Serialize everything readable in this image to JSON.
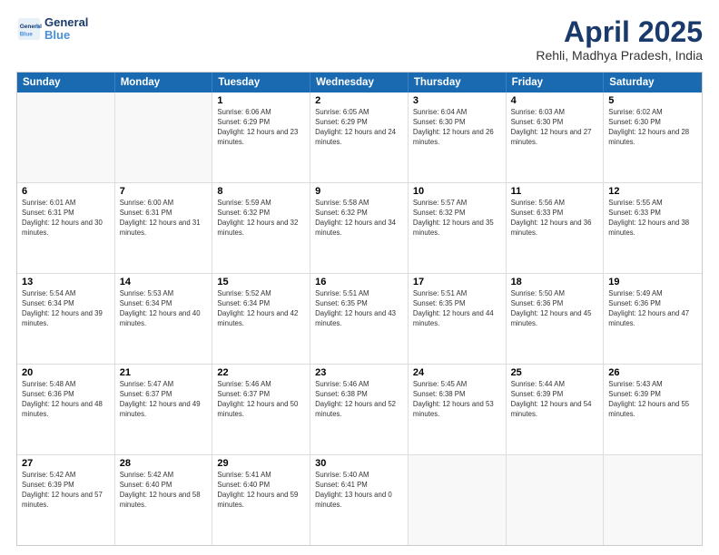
{
  "header": {
    "logo_line1": "General",
    "logo_line2": "Blue",
    "month": "April 2025",
    "location": "Rehli, Madhya Pradesh, India"
  },
  "days_of_week": [
    "Sunday",
    "Monday",
    "Tuesday",
    "Wednesday",
    "Thursday",
    "Friday",
    "Saturday"
  ],
  "weeks": [
    [
      {
        "day": "",
        "sunrise": "",
        "sunset": "",
        "daylight": ""
      },
      {
        "day": "",
        "sunrise": "",
        "sunset": "",
        "daylight": ""
      },
      {
        "day": "1",
        "sunrise": "Sunrise: 6:06 AM",
        "sunset": "Sunset: 6:29 PM",
        "daylight": "Daylight: 12 hours and 23 minutes."
      },
      {
        "day": "2",
        "sunrise": "Sunrise: 6:05 AM",
        "sunset": "Sunset: 6:29 PM",
        "daylight": "Daylight: 12 hours and 24 minutes."
      },
      {
        "day": "3",
        "sunrise": "Sunrise: 6:04 AM",
        "sunset": "Sunset: 6:30 PM",
        "daylight": "Daylight: 12 hours and 26 minutes."
      },
      {
        "day": "4",
        "sunrise": "Sunrise: 6:03 AM",
        "sunset": "Sunset: 6:30 PM",
        "daylight": "Daylight: 12 hours and 27 minutes."
      },
      {
        "day": "5",
        "sunrise": "Sunrise: 6:02 AM",
        "sunset": "Sunset: 6:30 PM",
        "daylight": "Daylight: 12 hours and 28 minutes."
      }
    ],
    [
      {
        "day": "6",
        "sunrise": "Sunrise: 6:01 AM",
        "sunset": "Sunset: 6:31 PM",
        "daylight": "Daylight: 12 hours and 30 minutes."
      },
      {
        "day": "7",
        "sunrise": "Sunrise: 6:00 AM",
        "sunset": "Sunset: 6:31 PM",
        "daylight": "Daylight: 12 hours and 31 minutes."
      },
      {
        "day": "8",
        "sunrise": "Sunrise: 5:59 AM",
        "sunset": "Sunset: 6:32 PM",
        "daylight": "Daylight: 12 hours and 32 minutes."
      },
      {
        "day": "9",
        "sunrise": "Sunrise: 5:58 AM",
        "sunset": "Sunset: 6:32 PM",
        "daylight": "Daylight: 12 hours and 34 minutes."
      },
      {
        "day": "10",
        "sunrise": "Sunrise: 5:57 AM",
        "sunset": "Sunset: 6:32 PM",
        "daylight": "Daylight: 12 hours and 35 minutes."
      },
      {
        "day": "11",
        "sunrise": "Sunrise: 5:56 AM",
        "sunset": "Sunset: 6:33 PM",
        "daylight": "Daylight: 12 hours and 36 minutes."
      },
      {
        "day": "12",
        "sunrise": "Sunrise: 5:55 AM",
        "sunset": "Sunset: 6:33 PM",
        "daylight": "Daylight: 12 hours and 38 minutes."
      }
    ],
    [
      {
        "day": "13",
        "sunrise": "Sunrise: 5:54 AM",
        "sunset": "Sunset: 6:34 PM",
        "daylight": "Daylight: 12 hours and 39 minutes."
      },
      {
        "day": "14",
        "sunrise": "Sunrise: 5:53 AM",
        "sunset": "Sunset: 6:34 PM",
        "daylight": "Daylight: 12 hours and 40 minutes."
      },
      {
        "day": "15",
        "sunrise": "Sunrise: 5:52 AM",
        "sunset": "Sunset: 6:34 PM",
        "daylight": "Daylight: 12 hours and 42 minutes."
      },
      {
        "day": "16",
        "sunrise": "Sunrise: 5:51 AM",
        "sunset": "Sunset: 6:35 PM",
        "daylight": "Daylight: 12 hours and 43 minutes."
      },
      {
        "day": "17",
        "sunrise": "Sunrise: 5:51 AM",
        "sunset": "Sunset: 6:35 PM",
        "daylight": "Daylight: 12 hours and 44 minutes."
      },
      {
        "day": "18",
        "sunrise": "Sunrise: 5:50 AM",
        "sunset": "Sunset: 6:36 PM",
        "daylight": "Daylight: 12 hours and 45 minutes."
      },
      {
        "day": "19",
        "sunrise": "Sunrise: 5:49 AM",
        "sunset": "Sunset: 6:36 PM",
        "daylight": "Daylight: 12 hours and 47 minutes."
      }
    ],
    [
      {
        "day": "20",
        "sunrise": "Sunrise: 5:48 AM",
        "sunset": "Sunset: 6:36 PM",
        "daylight": "Daylight: 12 hours and 48 minutes."
      },
      {
        "day": "21",
        "sunrise": "Sunrise: 5:47 AM",
        "sunset": "Sunset: 6:37 PM",
        "daylight": "Daylight: 12 hours and 49 minutes."
      },
      {
        "day": "22",
        "sunrise": "Sunrise: 5:46 AM",
        "sunset": "Sunset: 6:37 PM",
        "daylight": "Daylight: 12 hours and 50 minutes."
      },
      {
        "day": "23",
        "sunrise": "Sunrise: 5:46 AM",
        "sunset": "Sunset: 6:38 PM",
        "daylight": "Daylight: 12 hours and 52 minutes."
      },
      {
        "day": "24",
        "sunrise": "Sunrise: 5:45 AM",
        "sunset": "Sunset: 6:38 PM",
        "daylight": "Daylight: 12 hours and 53 minutes."
      },
      {
        "day": "25",
        "sunrise": "Sunrise: 5:44 AM",
        "sunset": "Sunset: 6:39 PM",
        "daylight": "Daylight: 12 hours and 54 minutes."
      },
      {
        "day": "26",
        "sunrise": "Sunrise: 5:43 AM",
        "sunset": "Sunset: 6:39 PM",
        "daylight": "Daylight: 12 hours and 55 minutes."
      }
    ],
    [
      {
        "day": "27",
        "sunrise": "Sunrise: 5:42 AM",
        "sunset": "Sunset: 6:39 PM",
        "daylight": "Daylight: 12 hours and 57 minutes."
      },
      {
        "day": "28",
        "sunrise": "Sunrise: 5:42 AM",
        "sunset": "Sunset: 6:40 PM",
        "daylight": "Daylight: 12 hours and 58 minutes."
      },
      {
        "day": "29",
        "sunrise": "Sunrise: 5:41 AM",
        "sunset": "Sunset: 6:40 PM",
        "daylight": "Daylight: 12 hours and 59 minutes."
      },
      {
        "day": "30",
        "sunrise": "Sunrise: 5:40 AM",
        "sunset": "Sunset: 6:41 PM",
        "daylight": "Daylight: 13 hours and 0 minutes."
      },
      {
        "day": "",
        "sunrise": "",
        "sunset": "",
        "daylight": ""
      },
      {
        "day": "",
        "sunrise": "",
        "sunset": "",
        "daylight": ""
      },
      {
        "day": "",
        "sunrise": "",
        "sunset": "",
        "daylight": ""
      }
    ]
  ]
}
